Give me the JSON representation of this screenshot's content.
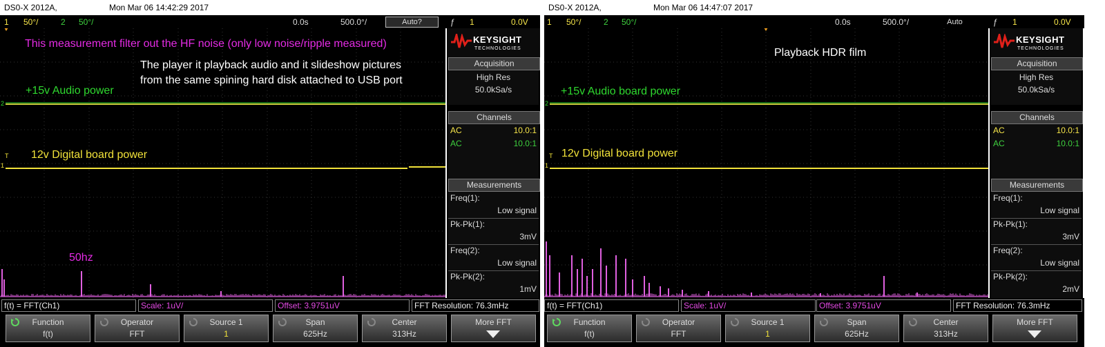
{
  "scopes": [
    {
      "model": "DS0-X 2012A,",
      "datetime": "Mon Mar 06 14:42:29 2017",
      "ch1_num": "1",
      "ch1_scale": "50°/",
      "ch2_num": "2",
      "ch2_scale": "50°/",
      "time_pos": "0.0s",
      "time_scale": "500.0°/",
      "trigger_mode": "Auto?",
      "trigger_ch": "1",
      "trigger_level": "0.0V",
      "annotations": {
        "note": "This measurement filter out the HF noise (only low noise/ripple measured)",
        "desc1": "The player it playback audio and it slideshow pictures",
        "desc2": "from the same  spining hard disk attached to USB port",
        "label_15v": "+15v Audio power",
        "label_12v": "12v Digital board power",
        "label_50hz": "50hz"
      },
      "panel": {
        "brand": "KEYSIGHT",
        "brand_sub": "TECHNOLOGIES",
        "acq_title": "Acquisition",
        "acq_mode": "High Res",
        "acq_rate": "50.0kSa/s",
        "chan_title": "Channels",
        "ch1_coupling": "AC",
        "ch1_probe": "10.0:1",
        "ch2_coupling": "AC",
        "ch2_probe": "10.0:1",
        "meas_title": "Measurements",
        "m1_label": "Freq(1):",
        "m1_value": "Low signal",
        "m2_label": "Pk-Pk(1):",
        "m2_value": "3mV",
        "m3_label": "Freq(2):",
        "m3_value": "Low signal",
        "m4_label": "Pk-Pk(2):",
        "m4_value": "1mV"
      },
      "fft": {
        "func": "f(t) = FFT(Ch1)",
        "scale": "Scale: 1uV/",
        "offset": "Offset: 3.9751uV",
        "resolution": "FFT Resolution: 76.3mHz"
      },
      "softkeys": [
        {
          "title": "Function",
          "value": "f(t)"
        },
        {
          "title": "Operator",
          "value": "FFT"
        },
        {
          "title": "Source 1",
          "value": "1"
        },
        {
          "title": "Span",
          "value": "625Hz"
        },
        {
          "title": "Center",
          "value": "313Hz"
        },
        {
          "title": "More FFT",
          "value": ""
        }
      ]
    },
    {
      "model": "DS0-X 2012A,",
      "datetime": "Mon Mar 06 14:47:07 2017",
      "ch1_num": "1",
      "ch1_scale": "50°/",
      "ch2_num": "2",
      "ch2_scale": "50°/",
      "time_pos": "0.0s",
      "time_scale": "500.0°/",
      "trigger_mode": "Auto",
      "trigger_ch": "1",
      "trigger_level": "0.0V",
      "annotations": {
        "note": "Playback HDR film",
        "label_15v": "+15v Audio board power",
        "label_12v": "12v Digital board power"
      },
      "panel": {
        "brand": "KEYSIGHT",
        "brand_sub": "TECHNOLOGIES",
        "acq_title": "Acquisition",
        "acq_mode": "High Res",
        "acq_rate": "50.0kSa/s",
        "chan_title": "Channels",
        "ch1_coupling": "AC",
        "ch1_probe": "10.0:1",
        "ch2_coupling": "AC",
        "ch2_probe": "10.0:1",
        "meas_title": "Measurements",
        "m1_label": "Freq(1):",
        "m1_value": "Low signal",
        "m2_label": "Pk-Pk(1):",
        "m2_value": "3mV",
        "m3_label": "Freq(2):",
        "m3_value": "Low signal",
        "m4_label": "Pk-Pk(2):",
        "m4_value": "2mV"
      },
      "fft": {
        "func": "f(t) = FFT(Ch1)",
        "scale": "Scale: 1uV/",
        "offset": "Offset: 3.9751uV",
        "resolution": "FFT Resolution: 76.3mHz"
      },
      "softkeys": [
        {
          "title": "Function",
          "value": "f(t)"
        },
        {
          "title": "Operator",
          "value": "FFT"
        },
        {
          "title": "Source 1",
          "value": "1"
        },
        {
          "title": "Span",
          "value": "625Hz"
        },
        {
          "title": "Center",
          "value": "313Hz"
        },
        {
          "title": "More FFT",
          "value": ""
        }
      ]
    }
  ],
  "colors": {
    "ch1": "#f2e33a",
    "ch2": "#2fd82f",
    "math": "#e52be5",
    "grid": "#3c3c3c"
  }
}
